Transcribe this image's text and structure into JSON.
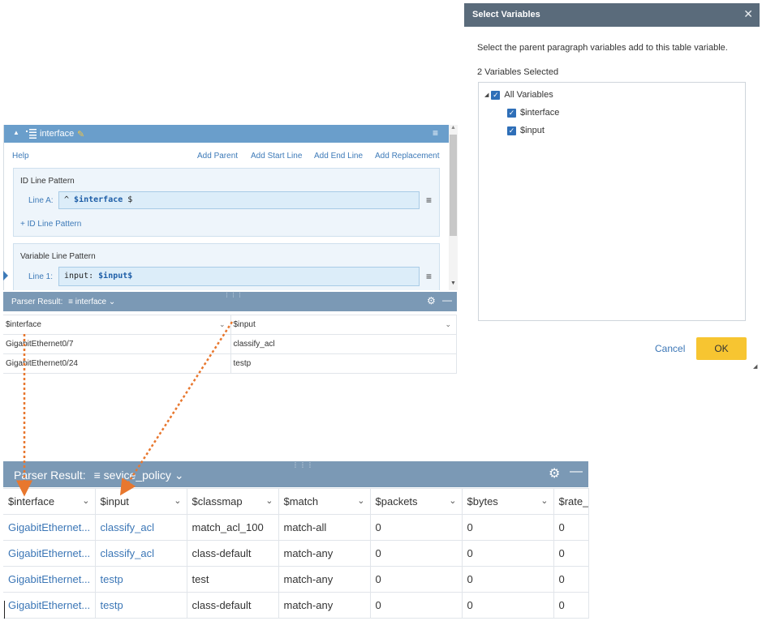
{
  "editor": {
    "title": "interface",
    "links": [
      "Help",
      "Add Parent",
      "Add Start Line",
      "Add End Line",
      "Add Replacement"
    ],
    "id_section": {
      "title": "ID Line Pattern",
      "line_label": "Line A:",
      "pattern_prefix": "^ ",
      "pattern_var": "$interface",
      "pattern_suffix": " $",
      "add_label": "+ ID Line Pattern"
    },
    "var_section": {
      "title": "Variable Line Pattern",
      "line_label": "Line 1:",
      "pattern_prefix": "input: ",
      "pattern_var": "$input$"
    }
  },
  "parser_small": {
    "label": "Parser Result:",
    "selected": "interface",
    "columns": [
      "$interface",
      "$input"
    ],
    "rows": [
      [
        "GigabitEthernet0/7",
        "classify_acl"
      ],
      [
        "GigabitEthernet0/24",
        "testp"
      ]
    ]
  },
  "parser_big": {
    "label": "Parser Result:",
    "selected": "sevice_policy",
    "columns": [
      "$interface",
      "$input",
      "$classmap",
      "$match",
      "$packets",
      "$bytes",
      "$rate_"
    ],
    "rows": [
      [
        "GigabitEthernet...",
        "classify_acl",
        "match_acl_100",
        "match-all",
        "0",
        "0",
        "0"
      ],
      [
        "GigabitEthernet...",
        "classify_acl",
        "class-default",
        "match-any",
        "0",
        "0",
        "0"
      ],
      [
        "GigabitEthernet...",
        "testp",
        "test",
        "match-any",
        "0",
        "0",
        "0"
      ],
      [
        "GigabitEthernet...",
        "testp",
        "class-default",
        "match-any",
        "0",
        "0",
        "0"
      ]
    ]
  },
  "dialog": {
    "title": "Select Variables",
    "description": "Select the parent paragraph variables add to this table variable.",
    "count_label": "2 Variables Selected",
    "tree": {
      "root": "All Variables",
      "children": [
        "$interface",
        "$input"
      ]
    },
    "cancel_label": "Cancel",
    "ok_label": "OK"
  },
  "icons": {
    "expand": "triangle-down-icon",
    "table": "table-icon",
    "edit": "pencil-icon",
    "menu": "hamburger-icon",
    "settings": "gear-icon",
    "minimize": "minus-icon",
    "close": "close-icon",
    "checkbox": "checkbox-checked-icon",
    "dropdown": "chevron-down-icon"
  },
  "colors": {
    "editor_header": "#6a9ecb",
    "result_bar": "#7b99b5",
    "dialog_header": "#5a6b7b",
    "link_blue": "#3b76b6",
    "ok_button": "#f7c531",
    "arrow_orange": "#e8772e"
  }
}
